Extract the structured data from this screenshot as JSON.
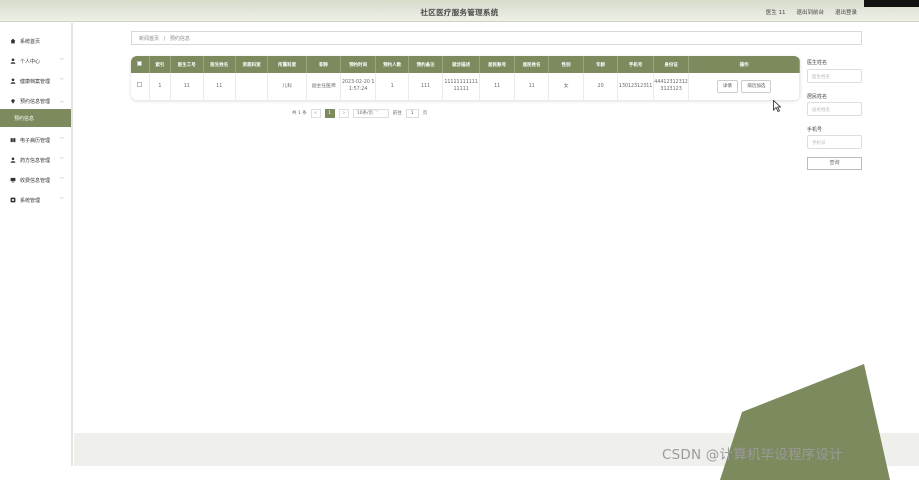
{
  "header": {
    "title": "社区医疗服务管理系统",
    "user": "医生 11",
    "back_label": "退出到前台",
    "logout_label": "退出登录"
  },
  "sidebar": {
    "items": [
      {
        "label": "系统首页",
        "icon": "home-icon"
      },
      {
        "label": "个人中心",
        "icon": "user-icon"
      },
      {
        "label": "健康档案管理",
        "icon": "person-icon"
      },
      {
        "label": "预约信息管理",
        "icon": "pin-icon"
      },
      {
        "label": "预约信息",
        "icon": ""
      },
      {
        "label": "电子病历管理",
        "icon": "book-icon"
      },
      {
        "label": "药方信息管理",
        "icon": "person-icon"
      },
      {
        "label": "收费信息管理",
        "icon": "monitor-icon"
      },
      {
        "label": "系统管理",
        "icon": "box-icon"
      }
    ]
  },
  "breadcrumb": {
    "home": "新闻首页",
    "sep": "/",
    "current": "预约信息"
  },
  "table": {
    "headers": [
      "",
      "索引",
      "医生工号",
      "医生姓名",
      "资质科室",
      "所属科室",
      "职称",
      "预约时间",
      "预约人数",
      "预约备注",
      "就诊描述",
      "居民账号",
      "居民姓名",
      "性别",
      "年龄",
      "手机号",
      "身份证",
      "操作"
    ],
    "rows": [
      {
        "index": "1",
        "doc_no": "11",
        "doc_name": "11",
        "qual": "",
        "dept": "儿科",
        "title": "副主任医师",
        "time": "2023-02-20 11:57:24",
        "count": "1",
        "note": "111",
        "desc": "1111111111111111",
        "res_acc": "11",
        "res_name": "11",
        "gender": "女",
        "age": "20",
        "phone": "13012312311",
        "idcard": "444123123123123123"
      }
    ],
    "actions": {
      "detail": "详情",
      "add_record": "病历加选"
    }
  },
  "pager": {
    "total": "共 1 条",
    "prev": "<",
    "page": "1",
    "next": ">",
    "size": "10条/页",
    "goto": "前往",
    "goto_val": "1",
    "goto_unit": "页"
  },
  "search": {
    "doctor_label": "医生姓名",
    "doctor_ph": "医生姓名",
    "resident_label": "居民姓名",
    "resident_ph": "居民姓名",
    "phone_label": "手机号",
    "phone_ph": "手机号",
    "button": "查询"
  },
  "watermark": "CSDN @计算机毕设程序设计",
  "colors": {
    "accent": "#7c8a5e",
    "header_bg": "#dfe3d4"
  }
}
